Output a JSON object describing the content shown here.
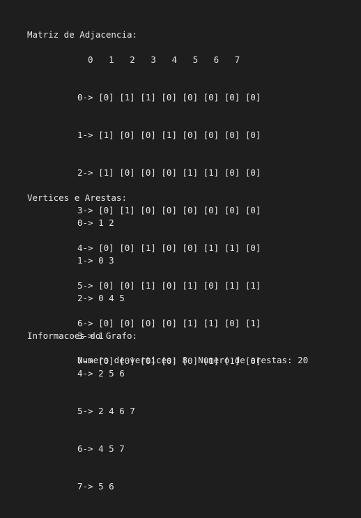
{
  "section_matrix": {
    "title": "Matriz de Adjacencia:",
    "header": "  0   1   2   3   4   5   6   7",
    "rows": [
      "0-> [0] [1] [1] [0] [0] [0] [0] [0]",
      "1-> [1] [0] [0] [1] [0] [0] [0] [0]",
      "2-> [1] [0] [0] [0] [1] [1] [0] [0]",
      "3-> [0] [1] [0] [0] [0] [0] [0] [0]",
      "4-> [0] [0] [1] [0] [0] [1] [1] [0]",
      "5-> [0] [0] [1] [0] [1] [0] [1] [1]",
      "6-> [0] [0] [0] [0] [1] [1] [0] [1]",
      "7-> [0] [0] [0] [0] [0] [1] [1] [0]"
    ]
  },
  "section_vertices": {
    "title": "Vertices e Arestas:",
    "rows": [
      "0-> 1 2",
      "1-> 0 3",
      "2-> 0 4 5",
      "3-> 1",
      "4-> 2 5 6",
      "5-> 2 4 6 7",
      "6-> 4 5 7",
      "7-> 5 6"
    ]
  },
  "section_info": {
    "title": "Informacoes do Grafo:",
    "summary": "Numero de vertices: 8  Numero de arestas: 20"
  },
  "colors": {
    "background": "#1e1e1e",
    "text": "#e6e6e6"
  }
}
